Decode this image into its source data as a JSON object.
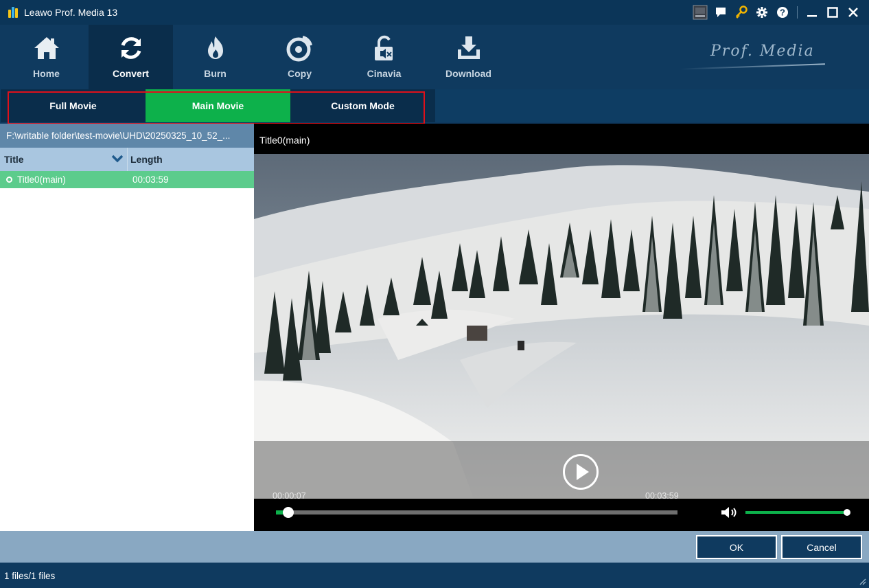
{
  "window": {
    "title": "Leawo Prof. Media 13"
  },
  "titlebar_icons": [
    "amd-icon",
    "feedback-icon",
    "key-icon",
    "settings-icon",
    "help-icon",
    "minimize-icon",
    "maximize-icon",
    "close-icon"
  ],
  "toolbar": {
    "items": [
      {
        "label": "Home",
        "icon": "home-icon",
        "active": false
      },
      {
        "label": "Convert",
        "icon": "convert-icon",
        "active": true
      },
      {
        "label": "Burn",
        "icon": "burn-icon",
        "active": false
      },
      {
        "label": "Copy",
        "icon": "copy-icon",
        "active": false
      },
      {
        "label": "Cinavia",
        "icon": "cinavia-icon",
        "active": false
      },
      {
        "label": "Download",
        "icon": "download-icon",
        "active": false
      }
    ],
    "brand": "Prof. Media"
  },
  "modes": {
    "items": [
      {
        "label": "Full Movie",
        "selected": false
      },
      {
        "label": "Main Movie",
        "selected": true
      },
      {
        "label": "Custom Mode",
        "selected": false
      }
    ],
    "highlight_color": "#e0101a"
  },
  "source": {
    "path": "F:\\writable folder\\test-movie\\UHD\\20250325_10_52_..."
  },
  "title_list": {
    "columns": {
      "title": "Title",
      "length": "Length"
    },
    "rows": [
      {
        "title": "Title0(main)",
        "length": "00:03:59",
        "selected": true
      }
    ]
  },
  "player": {
    "title": "Title0(main)",
    "current_time": "00:00:07",
    "total_time": "00:03:59",
    "progress": 0.03,
    "volume": 1.0
  },
  "actions": {
    "ok": "OK",
    "cancel": "Cancel"
  },
  "status": {
    "text": "1 files/1 files"
  },
  "colors": {
    "accent_green": "#0db14b",
    "row_green": "#5ccc8c",
    "dark_navy": "#0f3a5f",
    "panel_blue": "#5f87a9"
  }
}
